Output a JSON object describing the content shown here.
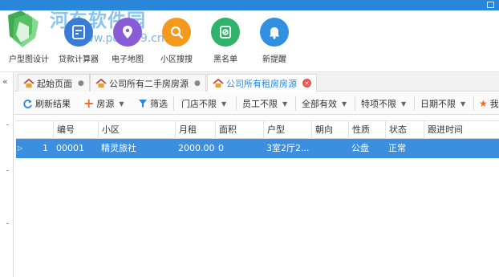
{
  "watermark": {
    "site": "河东软件园",
    "url": "www.pc0359.cn"
  },
  "ribbon": {
    "buttons": [
      {
        "label": "户型图设计",
        "icon": "house-layout-icon",
        "color": "#4cae4c"
      },
      {
        "label": "贷款计算器",
        "icon": "calculator-icon",
        "color": "#3a7bd5"
      },
      {
        "label": "电子地图",
        "icon": "map-pin-icon",
        "color": "#8a5bd6"
      },
      {
        "label": "小区搜搜",
        "icon": "search-icon",
        "color": "#f39a1e"
      },
      {
        "label": "黑名单",
        "icon": "blacklist-icon",
        "color": "#2fb26a"
      },
      {
        "label": "新提醒",
        "icon": "bell-icon",
        "color": "#2f8fe0"
      }
    ]
  },
  "tabs": [
    {
      "label": "起始页面",
      "icon": "home-icon",
      "active": false,
      "closable": false
    },
    {
      "label": "公司所有二手房房源",
      "icon": "home-icon",
      "active": false,
      "closable": false
    },
    {
      "label": "公司所有租房房源",
      "icon": "home-icon",
      "active": true,
      "closable": true
    }
  ],
  "toolbar": {
    "refresh": "刷新结果",
    "add": "房源",
    "filter": "筛选",
    "store": "门店不限",
    "staff": "员工不限",
    "valid": "全部有效",
    "feature": "特项不限",
    "date": "日期不限",
    "star": "我"
  },
  "grid": {
    "columns": [
      "编号",
      "小区",
      "月租",
      "面积",
      "户型",
      "朝向",
      "性质",
      "状态",
      "跟进时间"
    ],
    "rows": [
      {
        "index": "1",
        "code": "00001",
        "community": "精灵旅社",
        "rent": "2000.00",
        "area": "0",
        "layout": "3室2厅2...",
        "orientation": "",
        "nature": "公盘",
        "status": "正常",
        "follow_time": ""
      }
    ]
  },
  "colors": {
    "accent": "#2a86d8",
    "selected_row": "#3b8fde",
    "refresh": "#2a86d8",
    "add": "#e96b2c",
    "filter": "#2a86d8",
    "star": "#e96b2c"
  }
}
